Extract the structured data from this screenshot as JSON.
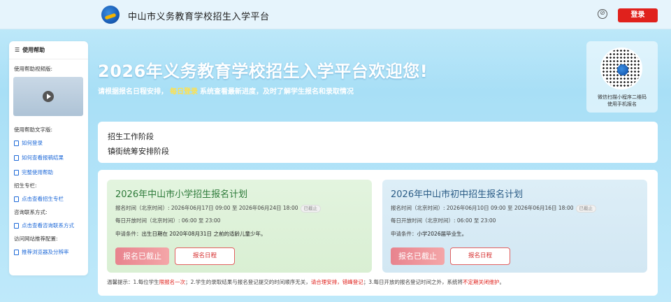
{
  "header": {
    "site_title": "中山市义务教育学校招生入学平台",
    "login_label": "登录",
    "settings_icon": "⊘"
  },
  "sidebar": {
    "title": "使用帮助",
    "video_label": "使用帮助视频版:",
    "text_label": "使用帮助文字版:",
    "links_text": [
      "如何登录",
      "如何查看报稿结果",
      "完整使用帮助"
    ],
    "column_label": "招生专栏:",
    "column_link": "点击查看招生专栏",
    "contact_label": "咨询联系方式:",
    "contact_link": "点击查看咨询联系方式",
    "config_label": "访问网站推荐配置:",
    "config_link": "推荐浏览器及分辨率"
  },
  "banner": {
    "title": "2026年义务教育学校招生入学平台欢迎您!",
    "subtitle_pre": "请根据报名日程安排，",
    "subtitle_highlight": "每日登录",
    "subtitle_post": "系统查看最新进度，及时了解学生报名和录取情况"
  },
  "qr": {
    "line1": "微信扫描小程序二维码",
    "line2": "使用手机报名"
  },
  "stage": {
    "title": "招生工作阶段",
    "value": "镇街统筹安排阶段"
  },
  "plans": [
    {
      "title": "2026年中山市小学招生报名计划",
      "time": "报名时间（北京时间）: 2026年06月17日 09:00 至 2026年06月24日 18:00",
      "status": "已截止",
      "daily": "每日开放时间（北京时间）: 06:00 至 23:00",
      "condition_label": "申请条件：",
      "condition": "出生日期在 2020年08月31日 之前的适龄儿童少年。",
      "closed_label": "报名已截止",
      "schedule_label": "报名日程"
    },
    {
      "title": "2026年中山市初中招生报名计划",
      "time": "报名时间（北京时间）: 2026年06月10日 09:00 至 2026年06月16日 18:00",
      "status": "已截止",
      "daily": "每日开放时间（北京时间）: 06:00 至 23:00",
      "condition_label": "申请条件：",
      "condition": "小学2026届毕业生。",
      "closed_label": "报名已截止",
      "schedule_label": "报名日程"
    }
  ],
  "tip": {
    "p1": "温馨提示：1.每位学生",
    "r1": "限报名一次",
    "p2": "；2.学生的录取结果与报名登记提交的时间顺序无关，",
    "r2": "请合理安排，错峰登记",
    "p3": "；3.每日开放的报名登记时间之外，系统将",
    "r3": "不定期关闭维护",
    "p4": "。"
  },
  "colors": {
    "brand_red": "#e0211c",
    "link_blue": "#1f6ad8",
    "highlight_yellow": "#ffe14d"
  }
}
